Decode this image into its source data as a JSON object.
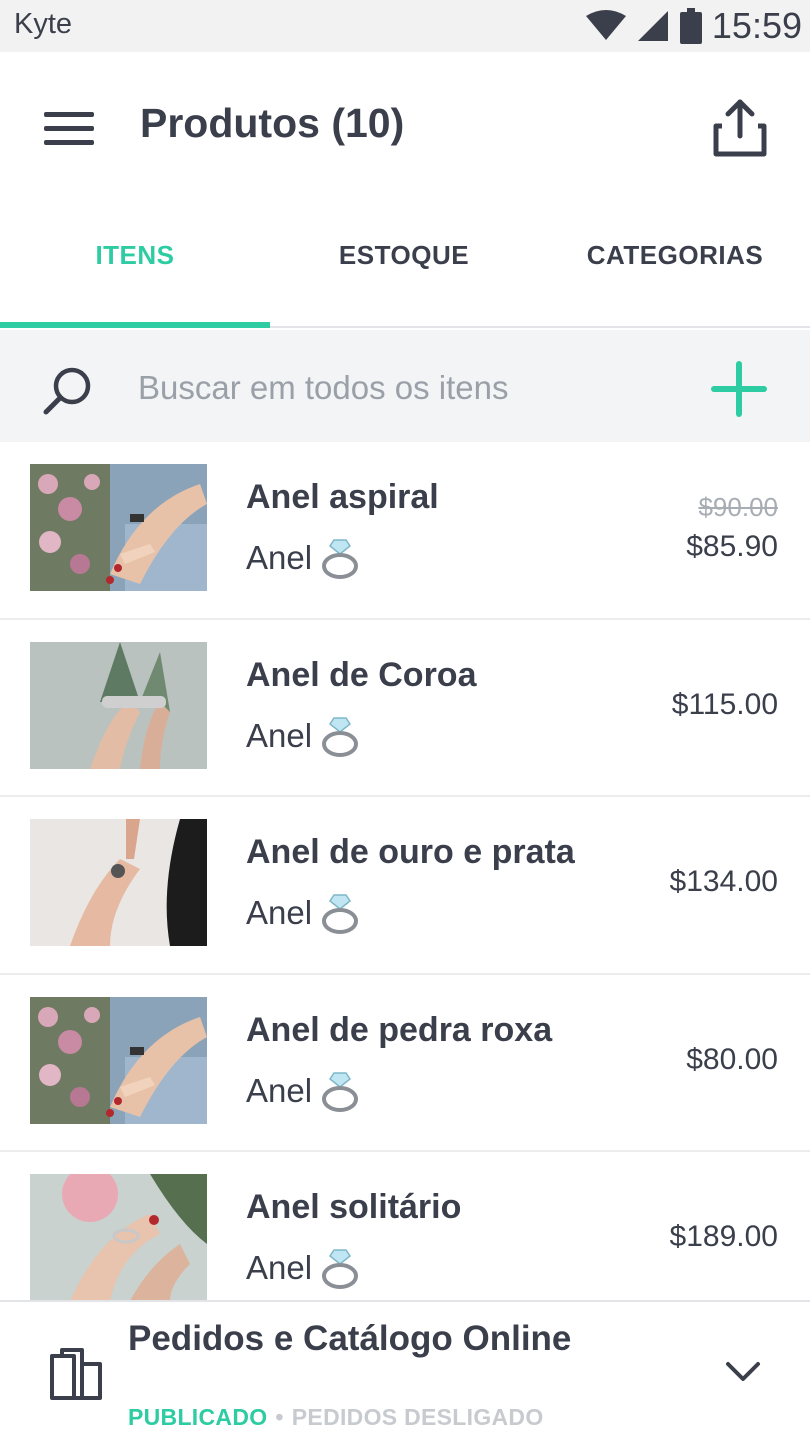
{
  "statusbar": {
    "app_name": "Kyte",
    "time": "15:59",
    "icons": [
      "wifi-icon",
      "signal-icon",
      "battery-icon"
    ]
  },
  "header": {
    "title": "Produtos (10)",
    "menu_icon": "menu-icon",
    "share_icon": "share-icon"
  },
  "tabs": [
    {
      "label": "ITENS",
      "active": true
    },
    {
      "label": "ESTOQUE",
      "active": false
    },
    {
      "label": "CATEGORIAS",
      "active": false
    }
  ],
  "search": {
    "placeholder": "Buscar em todos os itens",
    "value": "",
    "add_icon": "plus-icon"
  },
  "products": [
    {
      "name": "Anel aspiral",
      "category": "Anel",
      "category_icon": "ring-icon",
      "old_price": "$90.00",
      "price": "$85.90"
    },
    {
      "name": "Anel de Coroa",
      "category": "Anel",
      "category_icon": "ring-icon",
      "price": "$115.00"
    },
    {
      "name": "Anel de ouro e prata",
      "category": "Anel",
      "category_icon": "ring-icon",
      "price": "$134.00"
    },
    {
      "name": "Anel de pedra roxa",
      "category": "Anel",
      "category_icon": "ring-icon",
      "price": "$80.00"
    },
    {
      "name": "Anel solitário",
      "category": "Anel",
      "category_icon": "ring-icon",
      "price": "$189.00"
    }
  ],
  "catalog_bar": {
    "title": "Pedidos e Catálogo Online",
    "status_published": "PUBLICADO",
    "separator": "•",
    "status_orders": "PEDIDOS DESLIGADO",
    "icon": "book-icon"
  },
  "colors": {
    "accent": "#2dcca2",
    "text": "#3a3f4b",
    "muted": "#9aa0a8",
    "search_bg": "#f3f4f5"
  }
}
